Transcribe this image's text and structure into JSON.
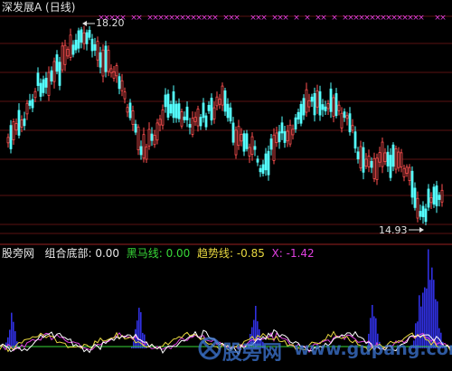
{
  "title": "深发展A (日线)",
  "price_chart": {
    "high_label": "18.20",
    "low_label": "14.93",
    "up_color": "#ff5050",
    "down_color": "#54ffff",
    "marker_color": "#e040e0",
    "marker_glyph": "×"
  },
  "indicator_bar": {
    "source": "股旁网",
    "name": "组合底部:",
    "name_value": "0.00",
    "black_horse_label": "黑马线:",
    "black_horse_value": "0.00",
    "trend_label": "趋势线:",
    "trend_value": "-0.85",
    "x_label": "X:",
    "x_value": "-1.42"
  },
  "watermark": {
    "text": "股旁网",
    "url": "www.gupang.com",
    "icon": "cross-logo-icon"
  },
  "colors": {
    "background": "#000000",
    "grid": "#5a1212",
    "separator": "#9a2020",
    "histogram": "#3030e0",
    "line_white": "#ffffff",
    "line_yellow": "#e8d840",
    "line_magenta": "#e040e0",
    "line_green": "#38d838"
  }
}
